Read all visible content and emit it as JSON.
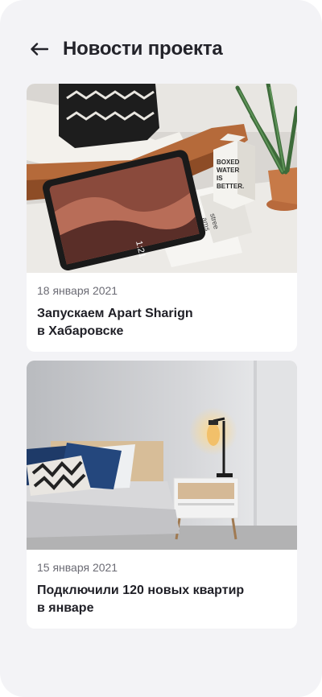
{
  "header": {
    "back_icon": "arrow-left-icon",
    "title": "Новости проекта"
  },
  "news": [
    {
      "date": "18 января 2021",
      "title": "Запускаем Apart Sharign\nв Хабаровске",
      "image": {
        "box_text": [
          "BOXED",
          "WATER",
          "IS",
          "BETTER."
        ],
        "magazine_text": [
          "stree",
          "ams"
        ],
        "tablet_clock": "1:21"
      }
    },
    {
      "date": "15 января 2021",
      "title": "Подключили 120 новых квартир\nв январе"
    }
  ]
}
